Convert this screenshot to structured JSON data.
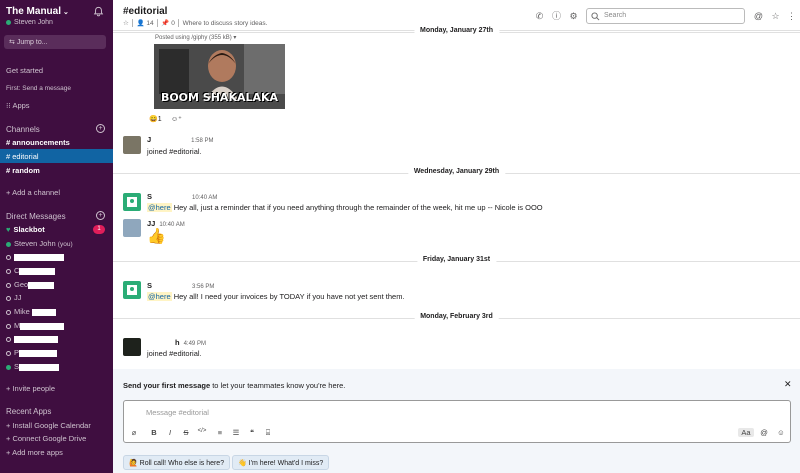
{
  "workspace": {
    "name": "The Manual",
    "user": "Steven John",
    "jump_to": "Jump to..."
  },
  "sidebar": {
    "get_started": "Get started",
    "first_step": "First: Send a message",
    "apps": "Apps",
    "channels_header": "Channels",
    "channels": [
      {
        "label": "announcements",
        "bold": true
      },
      {
        "label": "editorial",
        "active": true
      },
      {
        "label": "random",
        "bold": true
      }
    ],
    "add_channel": "Add a channel",
    "dm_header": "Direct Messages",
    "dms": [
      {
        "label": "Slackbot",
        "badge": "1"
      },
      {
        "label": "Steven John",
        "suffix": "(you)"
      },
      {
        "label": "",
        "redacted": true
      },
      {
        "label": "C",
        "redacted": true
      },
      {
        "label": "Geo",
        "redacted": true
      },
      {
        "label": "JJ"
      },
      {
        "label": "Mike"
      },
      {
        "label": "M",
        "redacted": true
      },
      {
        "label": "",
        "redacted": true
      },
      {
        "label": "P",
        "redacted": true
      },
      {
        "label": "S",
        "redacted": true
      }
    ],
    "invite": "Invite people",
    "recent_apps_header": "Recent Apps",
    "recent_apps": [
      "Install Google Calendar",
      "Connect Google Drive"
    ],
    "add_apps": "Add more apps"
  },
  "header": {
    "title": "#editorial",
    "member_count": "14",
    "pinned_count": "0",
    "topic": "Where to discuss story ideas.",
    "search_placeholder": "Search"
  },
  "messages": {
    "day1": "Monday, January 27th",
    "gif_meta": "Posted using /giphy (355 kB)",
    "gif_caption": "BOOM SHAKALAKA",
    "reaction_count": "1",
    "join1": {
      "name": "J",
      "time": "1:58 PM",
      "text": "joined #editorial."
    },
    "day2": "Wednesday, January 29th",
    "m1": {
      "name": "S",
      "time": "10:40 AM",
      "mention": "@here",
      "text": " Hey all, just a reminder that if you need anything through the remainder of the week, hit me up -- Nicole is OOO"
    },
    "m2": {
      "name": "JJ",
      "time": "10:40 AM"
    },
    "day3": "Friday, January 31st",
    "m3": {
      "name": "S",
      "time": "3:56 PM",
      "mention": "@here",
      "text": " Hey all! I need your invoices by TODAY if you have not yet sent them."
    },
    "day4": "Monday, February 3rd",
    "join2": {
      "name": "h",
      "time": "4:49 PM",
      "text": "joined #editorial."
    }
  },
  "banner": {
    "bold": "Send your first message",
    "rest": " to let your teammates know you're here."
  },
  "composer": {
    "placeholder": "Message #editorial",
    "aa_label": "Aa"
  },
  "suggestions": [
    "Roll call! Who else is here?",
    "I'm here! What'd I miss?"
  ]
}
